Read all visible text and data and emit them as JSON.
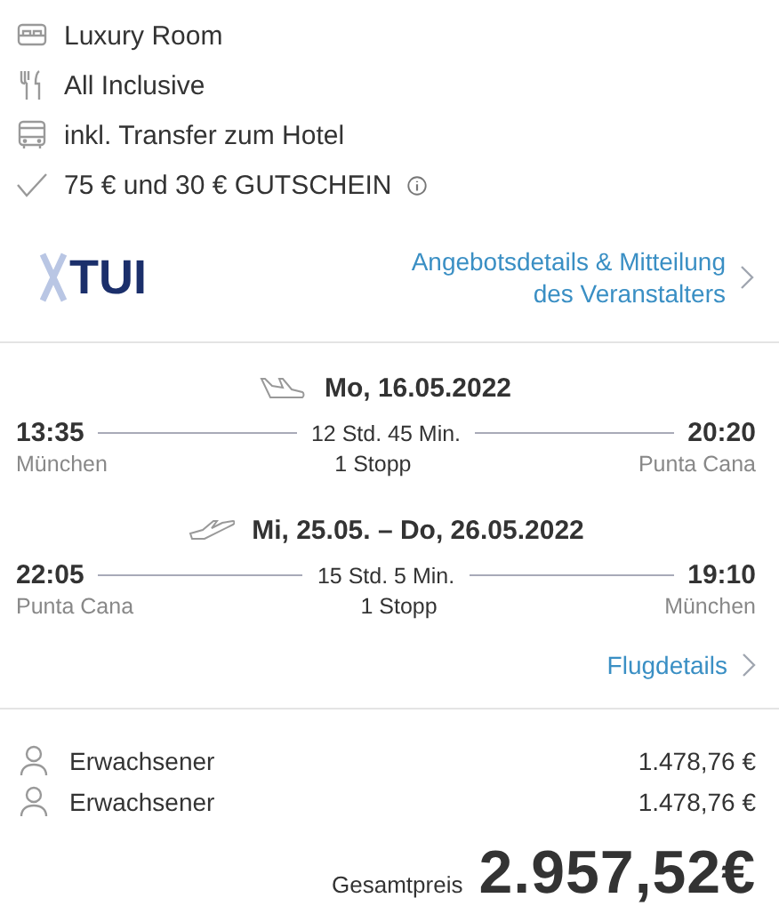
{
  "features": [
    {
      "kind": "bed",
      "label": "Luxury Room",
      "info": false
    },
    {
      "kind": "meal",
      "label": "All Inclusive",
      "info": false
    },
    {
      "kind": "bus",
      "label": "inkl. Transfer zum Hotel",
      "info": false
    },
    {
      "kind": "check",
      "label": "75 € und 30 € GUTSCHEIN",
      "info": true
    }
  ],
  "operator": {
    "logo": "TUI",
    "link": "Angebotsdetails & Mitteilung des Veranstalters"
  },
  "flights": [
    {
      "kind": "outbound",
      "date": "Mo, 16.05.2022",
      "departure_time": "13:35",
      "departure_city": "München",
      "duration": "12 Std. 45 Min.",
      "stops": "1 Stopp",
      "arrival_time": "20:20",
      "arrival_city": "Punta Cana"
    },
    {
      "kind": "return",
      "date": "Mi, 25.05. – Do, 26.05.2022",
      "departure_time": "22:05",
      "departure_city": "Punta Cana",
      "duration": "15 Std. 5 Min.",
      "stops": "1 Stopp",
      "arrival_time": "19:10",
      "arrival_city": "München"
    }
  ],
  "flight_details_link": "Flugdetails",
  "travellers": [
    {
      "label": "Erwachsener",
      "price": "1.478,76 €"
    },
    {
      "label": "Erwachsener",
      "price": "1.478,76 €"
    }
  ],
  "total": {
    "label": "Gesamtpreis",
    "price": "2.957,52€"
  }
}
